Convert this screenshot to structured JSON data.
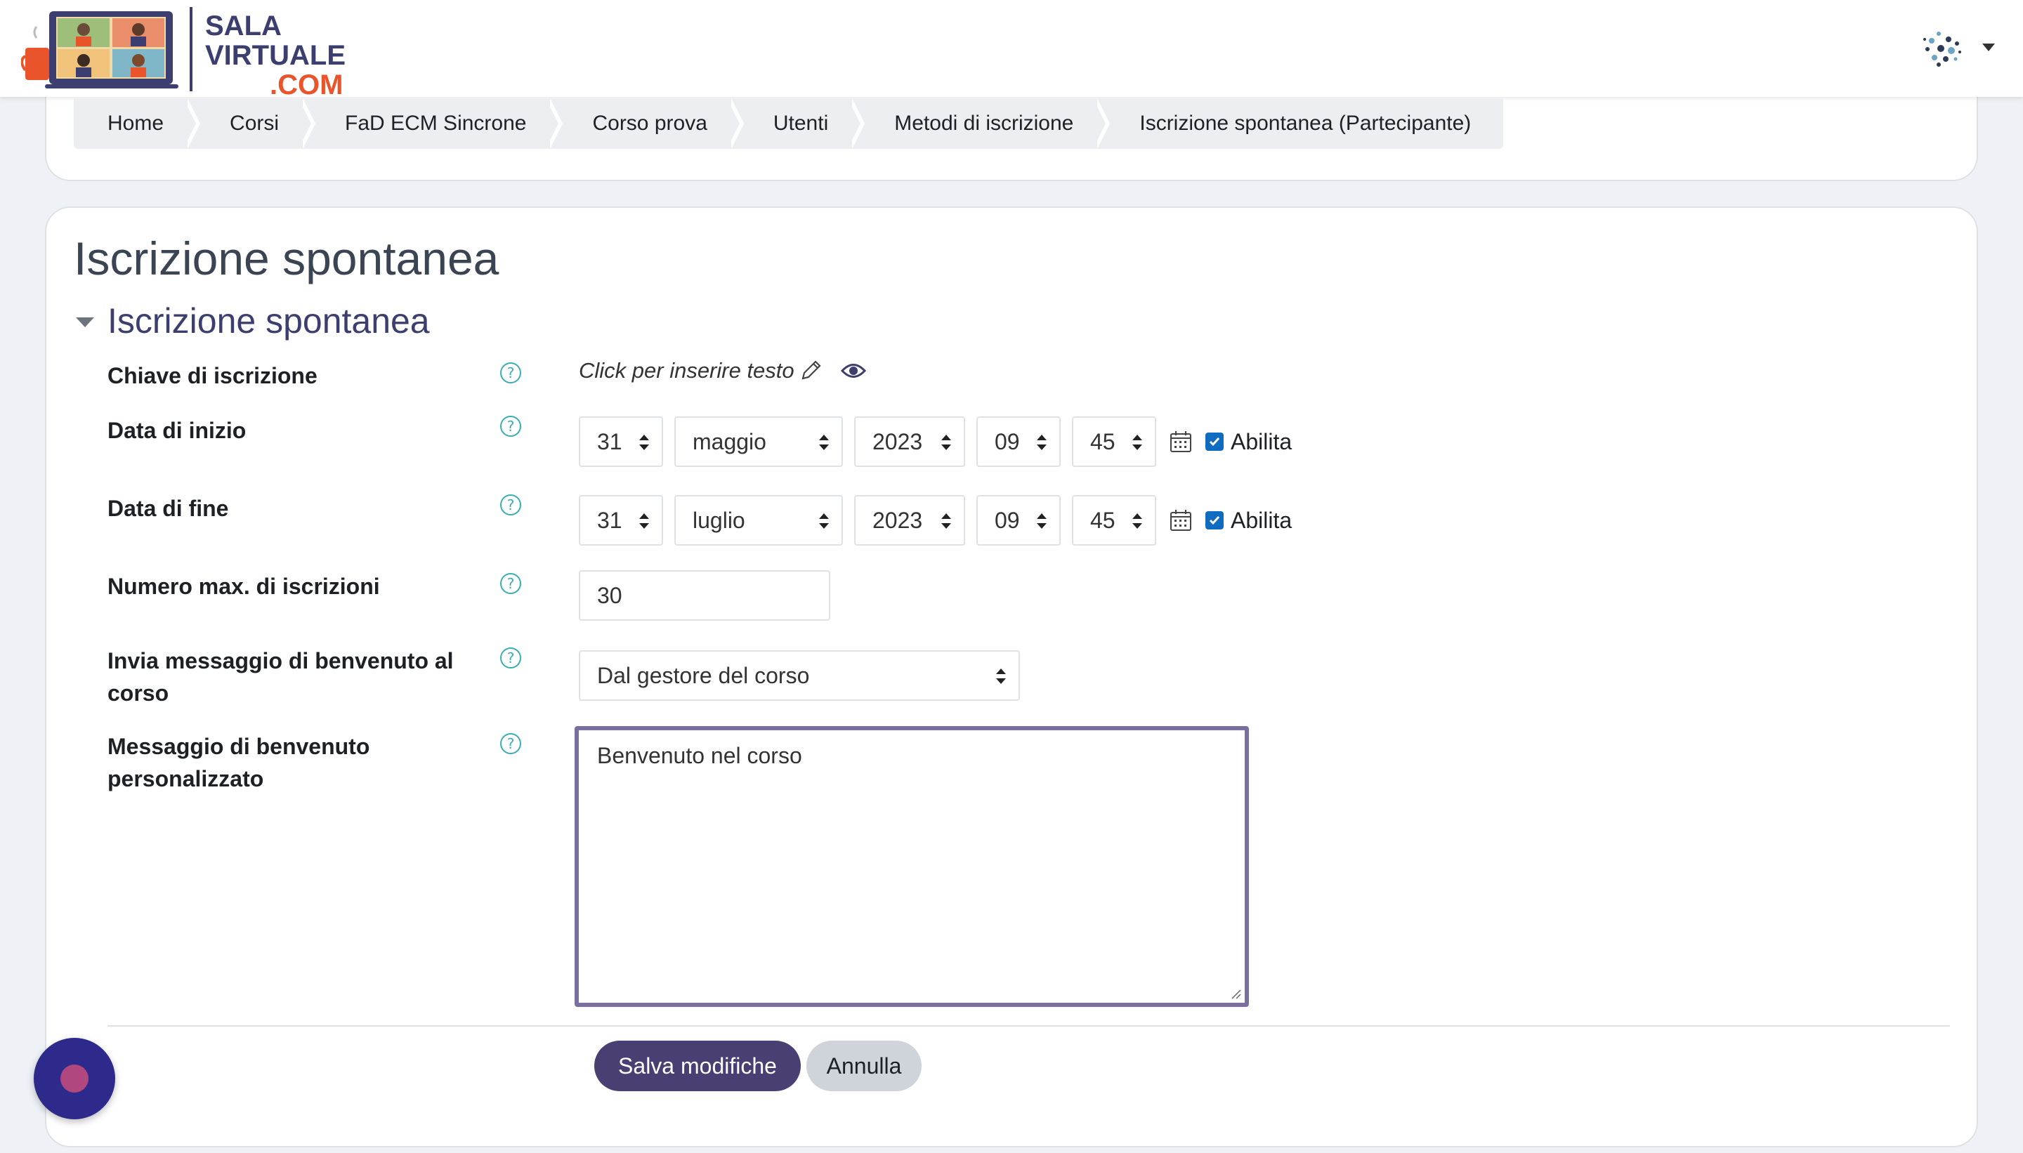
{
  "header": {
    "logo": {
      "line1": "SALA",
      "line2": "VIRTUALE",
      "line3": ".COM"
    },
    "user_menu": {
      "avatar_icon": "user-avatar-icon",
      "caret_icon": "chevron-down-icon"
    }
  },
  "breadcrumb": [
    "Home",
    "Corsi",
    "FaD ECM Sincrone",
    "Corso prova",
    "Utenti",
    "Metodi di iscrizione",
    "Iscrizione spontanea (Partecipante)"
  ],
  "page": {
    "title": "Iscrizione spontanea",
    "section_title": "Iscrizione spontanea"
  },
  "form": {
    "enrolment_key": {
      "label": "Chiave di iscrizione",
      "placeholder": "Click per inserire testo"
    },
    "start_date": {
      "label": "Data di inizio",
      "day": "31",
      "month": "maggio",
      "year": "2023",
      "hour": "09",
      "minute": "45",
      "enable_label": "Abilita",
      "enabled": true
    },
    "end_date": {
      "label": "Data di fine",
      "day": "31",
      "month": "luglio",
      "year": "2023",
      "hour": "09",
      "minute": "45",
      "enable_label": "Abilita",
      "enabled": true
    },
    "max_enrolled": {
      "label": "Numero max. di iscrizioni",
      "value": "30"
    },
    "welcome_message": {
      "label_line1": "Invia messaggio di benvenuto al",
      "label_line2": "corso",
      "value": "Dal gestore del corso"
    },
    "custom_welcome": {
      "label_line1": "Messaggio di benvenuto",
      "label_line2": "personalizzato",
      "value": "Benvenuto nel corso"
    }
  },
  "buttons": {
    "save": "Salva modifiche",
    "cancel": "Annulla"
  },
  "colors": {
    "primary": "#4a3f73",
    "help": "#3aaeb0",
    "checkbox": "#0f6cbf",
    "logo_dark": "#3b3e6e",
    "logo_accent": "#e9542b"
  }
}
